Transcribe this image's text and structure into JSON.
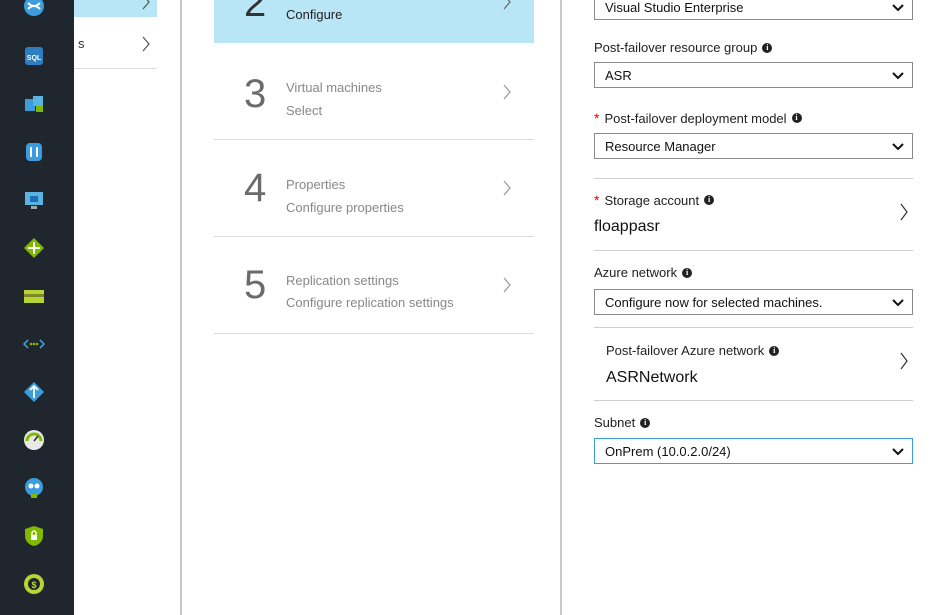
{
  "rail": {
    "icons": [
      "cloud-icon",
      "sql-database-icon",
      "app-service-icon",
      "cosmos-db-icon",
      "virtual-machine-icon",
      "load-balancer-icon",
      "storage-icon",
      "virtual-network-icon",
      "traffic-manager-icon",
      "monitor-icon",
      "app-insights-icon",
      "security-center-icon",
      "cost-management-icon"
    ],
    "sql_badge": "SQL"
  },
  "panel1": {
    "second_row_label": "s"
  },
  "steps": [
    {
      "number": "2",
      "title": "",
      "subtitle": "Configure",
      "active": true
    },
    {
      "number": "3",
      "title": "Virtual machines",
      "subtitle": "Select",
      "active": false
    },
    {
      "number": "4",
      "title": "Properties",
      "subtitle": "Configure properties",
      "active": false
    },
    {
      "number": "5",
      "title": "Replication settings",
      "subtitle": "Configure replication settings",
      "active": false
    }
  ],
  "form": {
    "subscription_value": "Visual Studio Enterprise",
    "resource_group": {
      "label": "Post-failover resource group",
      "value": "ASR"
    },
    "deployment_model": {
      "required_mark": "*",
      "label": "Post-failover deployment model",
      "value": "Resource Manager"
    },
    "storage_account": {
      "required_mark": "*",
      "label": "Storage account",
      "value": "floappasr"
    },
    "azure_network": {
      "label": "Azure network",
      "value": "Configure now for selected machines."
    },
    "post_failover_network": {
      "label": "Post-failover Azure network",
      "value": "ASRNetwork"
    },
    "subnet": {
      "label": "Subnet",
      "value": "OnPrem (10.0.2.0/24)"
    },
    "info_glyph": "i"
  },
  "colors": {
    "rail_bg": "#20262d",
    "active_bg": "#b9e6f7",
    "required": "#e00000",
    "focus_border": "#3aa0d8"
  }
}
